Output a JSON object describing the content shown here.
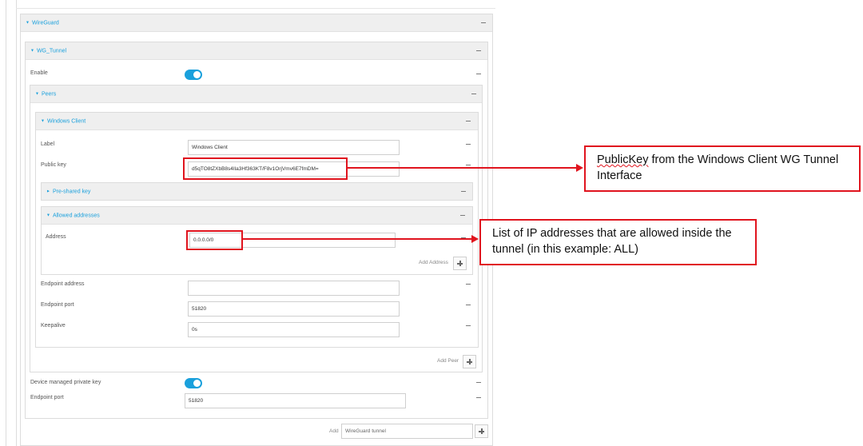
{
  "wireguard": {
    "title": "WireGuard",
    "tunnel": {
      "title": "WG_Tunnel",
      "enable_label": "Enable",
      "enable_on": true,
      "peers": {
        "title": "Peers",
        "peer": {
          "title": "Windows Client",
          "label_label": "Label",
          "label_value": "Windows Client",
          "public_key_label": "Public key",
          "public_key_value": "d5qTO8tZXbB8s4Ila3Hf363KT/F8v1OrjVmv6E7fmDM=",
          "preshared_title": "Pre-shared key",
          "allowed": {
            "title": "Allowed addresses",
            "address_label": "Address",
            "address_value": "0.0.0.0/0",
            "add_address": "Add Address"
          },
          "endpoint_address_label": "Endpoint address",
          "endpoint_address_value": "",
          "endpoint_port_label": "Endpoint port",
          "endpoint_port_value": "51820",
          "keepalive_label": "Keepalive",
          "keepalive_value": "0s"
        },
        "add_peer": "Add Peer"
      },
      "device_key_label": "Device managed private key",
      "device_key_on": true,
      "endpoint_port_label": "Endpoint port",
      "endpoint_port_value": "51820"
    },
    "add_label": "Add",
    "add_placeholder": "WireGuard tunnel"
  },
  "annotations": {
    "publickey_prefix": "PublicKey",
    "publickey_rest": " from the Windows Client WG Tunnel Interface",
    "allowed_text": "List of IP addresses that are allowed inside the tunnel (in this example: ALL)"
  },
  "colors": {
    "accent": "#1aa0dc",
    "annotation_red": "#e0141e"
  }
}
